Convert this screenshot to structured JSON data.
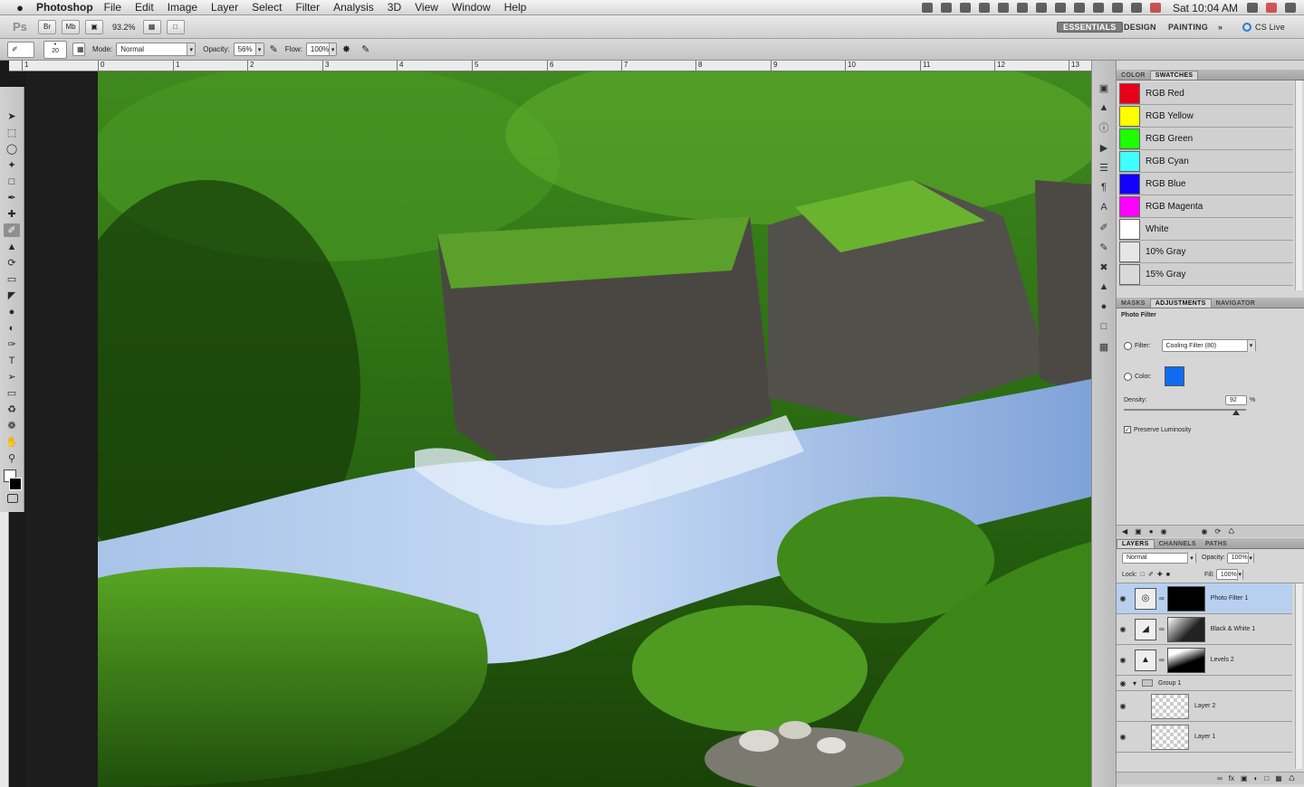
{
  "menubar": {
    "apple": "",
    "app": "Photoshop",
    "items": [
      "File",
      "Edit",
      "Image",
      "Layer",
      "Select",
      "Filter",
      "Analysis",
      "3D",
      "View",
      "Window",
      "Help"
    ],
    "clock": "Sat 10:04 AM"
  },
  "appbar": {
    "logo": "Ps",
    "bridge": "Br",
    "minibridge": "Mb",
    "zoom": "93.2%",
    "workspaces": {
      "active": "ESSENTIALS",
      "design": "DESIGN",
      "painting": "PAINTING",
      "more": "»"
    },
    "cslive": "CS Live"
  },
  "options": {
    "brush_size": "20",
    "mode_label": "Mode:",
    "mode_value": "Normal",
    "opacity_label": "Opacity:",
    "opacity_value": "56%",
    "flow_label": "Flow:",
    "flow_value": "100%"
  },
  "ruler": {
    "ticks": [
      "1",
      "0",
      "1",
      "2",
      "3",
      "4",
      "5",
      "6",
      "7",
      "8",
      "9",
      "10",
      "11",
      "12",
      "13"
    ]
  },
  "swatches": {
    "tabs": [
      "COLOR",
      "SWATCHES"
    ],
    "items": [
      {
        "name": "RGB Red",
        "color": "#e8001a"
      },
      {
        "name": "RGB Yellow",
        "color": "#ffff00"
      },
      {
        "name": "RGB Green",
        "color": "#1dff00"
      },
      {
        "name": "RGB Cyan",
        "color": "#40ffff"
      },
      {
        "name": "RGB Blue",
        "color": "#1400ff"
      },
      {
        "name": "RGB Magenta",
        "color": "#ff00ff"
      },
      {
        "name": "White",
        "color": "#ffffff"
      },
      {
        "name": "10% Gray",
        "color": "#e6e6e6"
      },
      {
        "name": "15% Gray",
        "color": "#d9d9d9"
      }
    ]
  },
  "adjustments": {
    "tabs": [
      "MASKS",
      "ADJUSTMENTS",
      "NAVIGATOR"
    ],
    "title": "Photo Filter",
    "filter_label": "Filter:",
    "filter_value": "Cooling Filter (80)",
    "color_label": "Color:",
    "filter_color": "#0f6cf0",
    "density_label": "Density:",
    "density_value": "92",
    "density_unit": "%",
    "density_level": 0.92,
    "preserve": "Preserve Luminosity"
  },
  "layers": {
    "tabs": [
      "LAYERS",
      "CHANNELS",
      "PATHS"
    ],
    "blend": "Normal",
    "opacity_label": "Opacity:",
    "opacity_value": "100%",
    "lock_label": "Lock:",
    "fill_label": "Fill:",
    "fill_value": "100%",
    "rows": [
      {
        "name": "Photo Filter 1",
        "kind": "adjust"
      },
      {
        "name": "Black & White 1",
        "kind": "adjust"
      },
      {
        "name": "Levels 2",
        "kind": "adjust"
      },
      {
        "name": "Group 1",
        "kind": "group"
      },
      {
        "name": "Layer 2",
        "kind": "pixel"
      },
      {
        "name": "Layer 1",
        "kind": "pixel"
      }
    ]
  }
}
